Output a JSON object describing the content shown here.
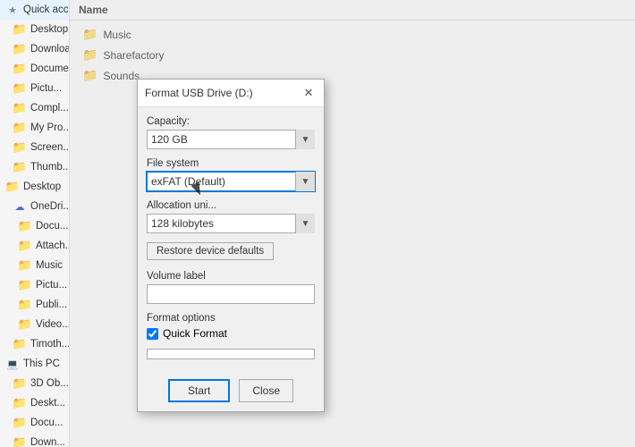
{
  "sidebar": {
    "items": [
      {
        "label": "Quick access",
        "icon": "star",
        "indent": 0
      },
      {
        "label": "Desktop",
        "icon": "folder",
        "indent": 1,
        "pinned": true
      },
      {
        "label": "Downloads",
        "icon": "folder",
        "indent": 1,
        "pinned": true
      },
      {
        "label": "Documents",
        "icon": "folder",
        "indent": 1,
        "pinned": true
      },
      {
        "label": "Pictures",
        "icon": "folder",
        "indent": 1,
        "pinned": false
      },
      {
        "label": "Compl...",
        "icon": "folder",
        "indent": 1
      },
      {
        "label": "My Pro...",
        "icon": "folder",
        "indent": 1
      },
      {
        "label": "Screen...",
        "icon": "folder",
        "indent": 1
      },
      {
        "label": "Thumb...",
        "icon": "folder",
        "indent": 1
      },
      {
        "label": "Desktop",
        "icon": "folder-blue",
        "indent": 0
      },
      {
        "label": "OneDri...",
        "icon": "folder-blue",
        "indent": 1
      },
      {
        "label": "Docu...",
        "icon": "folder",
        "indent": 2
      },
      {
        "label": "Attach...",
        "icon": "folder",
        "indent": 2
      },
      {
        "label": "Music",
        "icon": "folder",
        "indent": 2
      },
      {
        "label": "Pictu...",
        "icon": "folder",
        "indent": 2
      },
      {
        "label": "Publi...",
        "icon": "folder",
        "indent": 2
      },
      {
        "label": "Video...",
        "icon": "folder",
        "indent": 2
      },
      {
        "label": "Timoth...",
        "icon": "folder",
        "indent": 1
      },
      {
        "label": "This PC",
        "icon": "computer",
        "indent": 0
      },
      {
        "label": "3D Ob...",
        "icon": "folder",
        "indent": 1
      },
      {
        "label": "Deskt...",
        "icon": "folder",
        "indent": 1
      },
      {
        "label": "Docu...",
        "icon": "folder",
        "indent": 1
      },
      {
        "label": "Down...",
        "icon": "folder",
        "indent": 1
      }
    ]
  },
  "file_list": {
    "header": "Name",
    "items": [
      {
        "name": "Music",
        "type": "folder"
      },
      {
        "name": "Sharefactory",
        "type": "folder"
      },
      {
        "name": "Sounds",
        "type": "folder"
      }
    ]
  },
  "dialog": {
    "title": "Format USB Drive (D:)",
    "capacity_label": "Capacity:",
    "capacity_value": "120 GB",
    "filesystem_label": "File system",
    "filesystem_value": "exFAT (Default)",
    "allocation_label": "Allocation uni...",
    "allocation_value": "128 kilobytes",
    "restore_btn": "Restore device defaults",
    "volume_label": "Volume label",
    "volume_value": "",
    "format_options_label": "Format options",
    "quick_format_label": "Quick Format",
    "quick_format_checked": true,
    "start_btn": "Start",
    "close_btn": "Close"
  }
}
